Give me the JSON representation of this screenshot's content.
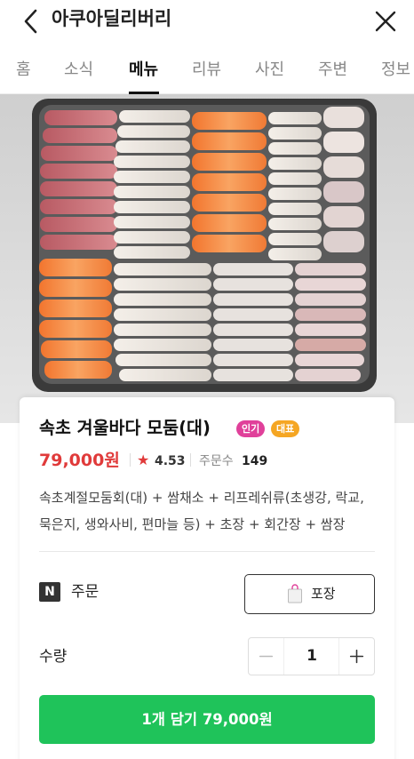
{
  "header": {
    "title": "아쿠아딜리버리",
    "back_icon": "chevron-left-icon",
    "close_icon": "close-icon"
  },
  "tabs": [
    {
      "label": "홈",
      "active": false
    },
    {
      "label": "소식",
      "active": false
    },
    {
      "label": "메뉴",
      "active": true
    },
    {
      "label": "리뷰",
      "active": false
    },
    {
      "label": "사진",
      "active": false
    },
    {
      "label": "주변",
      "active": false
    },
    {
      "label": "정보",
      "active": false
    }
  ],
  "menu": {
    "name": "속초 겨울바다 모둠(대)",
    "badges": [
      "인기",
      "대표"
    ],
    "price": "79,000원",
    "rating": "4.53",
    "orders_label": "주문수",
    "orders_count": "149",
    "description": "속초계절모둠회(대) + 쌈채소 + 리프레쉬류(초생강, 락교, 묵은지, 생와사비, 편마늘 등) + 초장 + 회간장 + 쌈장"
  },
  "order": {
    "logo_text": "N",
    "label": "주문",
    "pack_label": "포장"
  },
  "quantity": {
    "label": "수량",
    "value": "1"
  },
  "cart_button": "1개 담기 79,000원",
  "colors": {
    "accent_green": "#1fc35a",
    "price_red": "#e03a3a",
    "badge_pink": "#e0409a",
    "badge_orange": "#f5a623"
  }
}
